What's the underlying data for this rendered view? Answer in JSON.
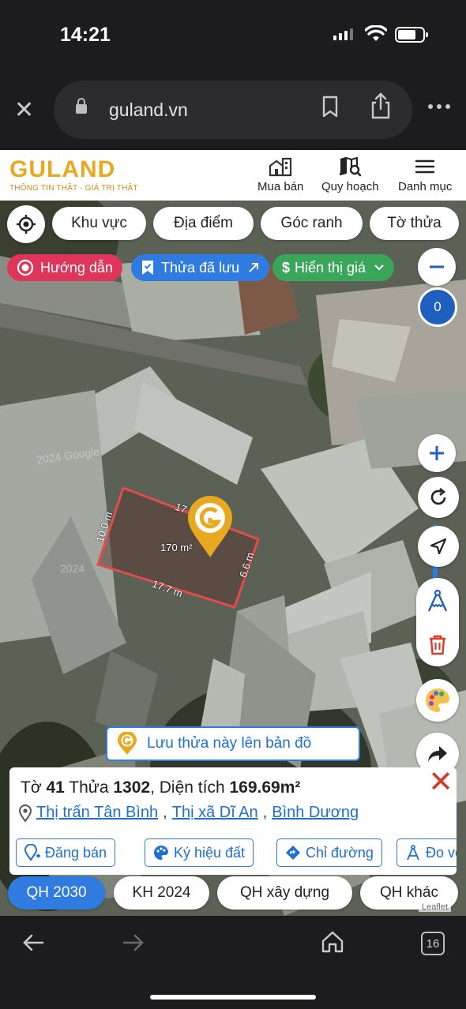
{
  "status": {
    "time": "14:21"
  },
  "browser": {
    "domain": "guland.vn"
  },
  "site": {
    "logo": "GULAND",
    "tagline": "THÔNG TIN THẬT - GIÁ TRỊ THẬT",
    "nav": [
      "Mua bán",
      "Quy hoạch",
      "Danh mục"
    ]
  },
  "filters": [
    "Khu vực",
    "Địa điểm",
    "Góc ranh",
    "Tờ thửa"
  ],
  "chips": {
    "guide": "Hướng dẫn",
    "saved": "Thửa đã lưu",
    "price": "Hiển thị giá"
  },
  "zoom": {
    "level": "0"
  },
  "parcel": {
    "area_label": "170 m²",
    "dim_top": "17",
    "dim_left": "10.0 m",
    "dim_bottom": "17.7 m",
    "dim_right": "6.6 m"
  },
  "watermarks": [
    "2024 Google",
    "2024"
  ],
  "save_banner": "Lưu thửa này lên bản đồ",
  "info": {
    "to_label": "Tờ",
    "to_value": "41",
    "thua_label": "Thửa",
    "thua_value": "1302",
    "area_label": ", Diện tích",
    "area_value": "169.69m²",
    "town": "Thị trấn Tân Bình",
    "district": "Thị xã Dĩ An",
    "province": "Bình Dương",
    "comma": ","
  },
  "actions": [
    "Đăng bán",
    "Ký hiệu đất",
    "Chỉ đường",
    "Đo vẽ"
  ],
  "layers": [
    "QH 2030",
    "KH 2024",
    "QH xây dựng",
    "QH khác"
  ],
  "attribution": "Leaflet",
  "bottom": {
    "tabs_count": "16"
  },
  "colors": {
    "brand": "#e8a820",
    "accent": "#2f7be0",
    "guide": "#e0355a",
    "price": "#3aa65a",
    "danger": "#d73b2b"
  }
}
